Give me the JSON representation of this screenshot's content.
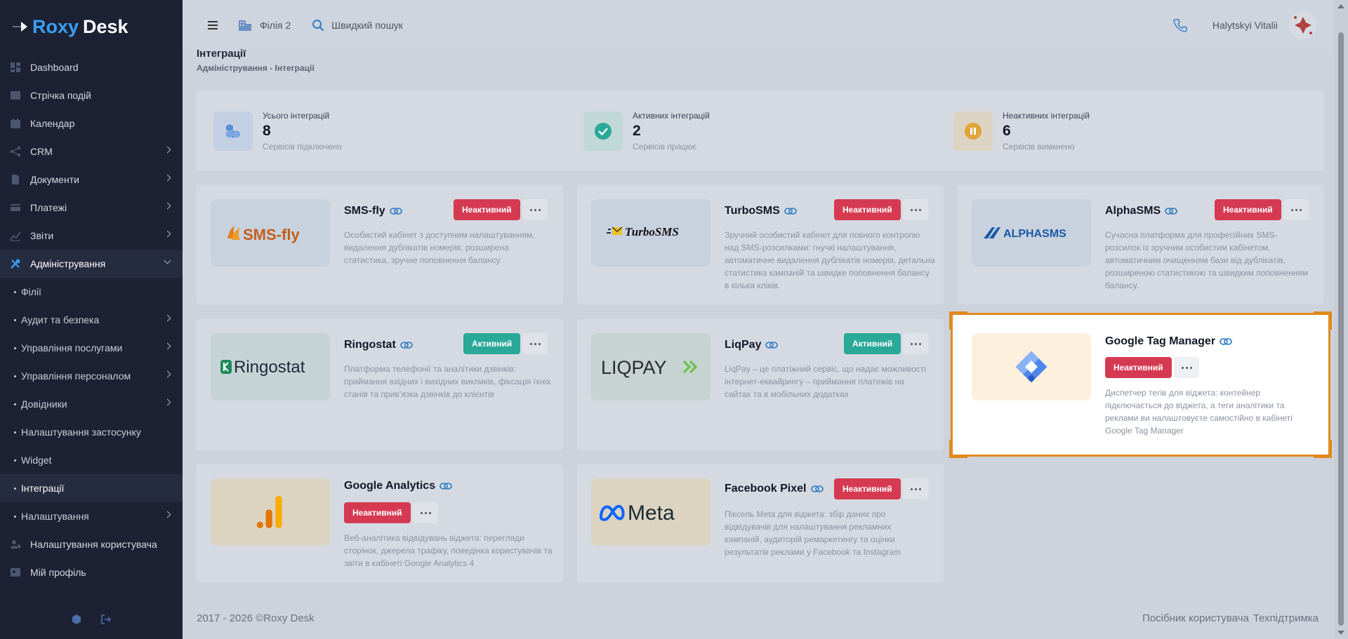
{
  "brand": {
    "part1": "Roxy",
    "part2": "Desk"
  },
  "sidebar": {
    "items": [
      {
        "label": "Dashboard",
        "icon": "dashboard-icon"
      },
      {
        "label": "Стрічка подій",
        "icon": "feed-icon"
      },
      {
        "label": "Календар",
        "icon": "calendar-icon"
      },
      {
        "label": "CRM",
        "icon": "crm-icon"
      },
      {
        "label": "Документи",
        "icon": "document-icon"
      },
      {
        "label": "Платежі",
        "icon": "payment-icon"
      },
      {
        "label": "Звіти",
        "icon": "chart-icon"
      },
      {
        "label": "Адміністрування",
        "icon": "tools-icon"
      }
    ],
    "subitems": [
      {
        "label": "Філії"
      },
      {
        "label": "Аудит та безпека"
      },
      {
        "label": "Управління послугами"
      },
      {
        "label": "Управління персоналом"
      },
      {
        "label": "Довідники"
      },
      {
        "label": "Налаштування застосунку"
      },
      {
        "label": "Widget"
      },
      {
        "label": "Інтеграції"
      },
      {
        "label": "Налаштування"
      }
    ],
    "bottom_items": [
      {
        "label": "Налаштування користувача",
        "icon": "user-settings-icon"
      },
      {
        "label": "Мій профіль",
        "icon": "profile-icon"
      }
    ]
  },
  "topbar": {
    "branch": "Філія 2",
    "search_label": "Швидкий пошук",
    "user_name": "Halytskyi Vitalii"
  },
  "page": {
    "title": "Інтеграції",
    "breadcrumb": "Адміністрування - Інтеграції"
  },
  "stats": [
    {
      "label": "Усього інтеграцій",
      "value": "8",
      "sub": "Сервісів підключено",
      "color": "#5b8fd6"
    },
    {
      "label": "Активних інтеграцій",
      "value": "2",
      "sub": "Сервісів працює",
      "color": "#2aa898"
    },
    {
      "label": "Неактивних інтеграцій",
      "value": "6",
      "sub": "Сервісів вимкнено",
      "color": "#e0a43a"
    }
  ],
  "integrations": [
    {
      "name": "SMS-fly",
      "logo_text": "SMS-fly",
      "status": "Неактивний",
      "active": false,
      "description": "Особистий кабінет з доступним налаштуванням, видалення дублікатів номерів, розширена статистика, зручне поповнення балансу"
    },
    {
      "name": "TurboSMS",
      "logo_text": "TurboSMS",
      "status": "Неактивний",
      "active": false,
      "description": "Зручний особистий кабінет для повного контролю над SMS-розсилками: гнучкі налаштування, автоматичне видалення дублікатів номерів, детальна статистика кампаній та швидке поповнення балансу в кілька кліків."
    },
    {
      "name": "AlphaSMS",
      "logo_text": "ALPHASMS",
      "status": "Неактивний",
      "active": false,
      "description": "Сучасна платформа для професійних SMS-розсилок із зручним особистим кабінетом, автоматичним очищенням бази від дублікатів, розширеною статистикою та швидким поповненням балансу."
    },
    {
      "name": "Ringostat",
      "logo_text": "Ringostat",
      "status": "Активний",
      "active": true,
      "description": "Платформа телефонії та аналітики дзвінків: приймання вхідних і вихідних викликів, фіксація їхніх станів та прив’язка дзвінків до клієнтів"
    },
    {
      "name": "LiqPay",
      "logo_text": "LIQPAY",
      "status": "Активний",
      "active": true,
      "description": "LiqPay – це платіжний сервіс, що надає можливості інтернет-еквайрингу – приймання платежів на сайтах та в мобільних додатках"
    },
    {
      "name": "Google Tag Manager",
      "logo_text": "",
      "status": "Неактивний",
      "active": false,
      "description": "Диспетчер тегів для віджета: контейнер підключається до віджета, а теги аналітики та реклами ви налаштовуєте самостійно в кабінеті Google Tag Manager"
    },
    {
      "name": "Google Analytics",
      "logo_text": "",
      "status": "Неактивний",
      "active": false,
      "description": "Веб-аналітика відвідувань віджета: перегляди сторінок, джерела трафіку, поведінка користувачів та звіти в кабінеті Google Analytics 4"
    },
    {
      "name": "Facebook Pixel",
      "logo_text": "Meta",
      "status": "Неактивний",
      "active": false,
      "description": "Піксель Meta для віджета: збір даних про відвідувачів для налаштування рекламних кампаній, аудиторій ремаркетингу та оцінки результатів реклами у Facebook та Instagram"
    }
  ],
  "footer": {
    "copyright": "2017 - 2026 ©Roxy Desk",
    "guide": "Посібник користувача",
    "support": "Техпідтримка"
  }
}
